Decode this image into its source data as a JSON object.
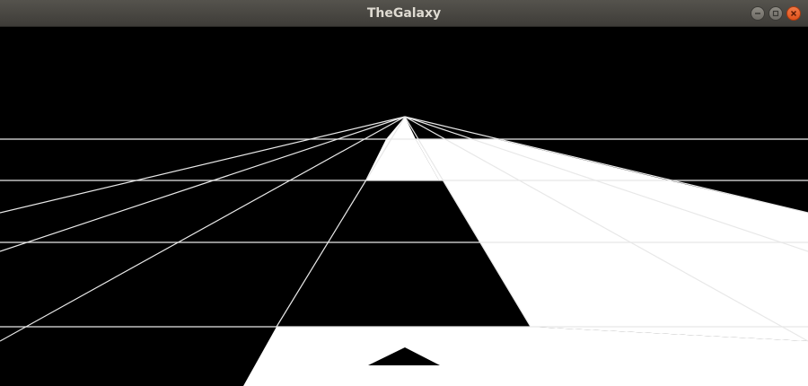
{
  "window": {
    "title": "TheGalaxy",
    "controls": [
      "minimize",
      "maximize",
      "close"
    ]
  },
  "game": {
    "background_color": "#000000",
    "grid_color": "#ffffff",
    "tile_color": "#ffffff",
    "ship_color": "#000000"
  }
}
